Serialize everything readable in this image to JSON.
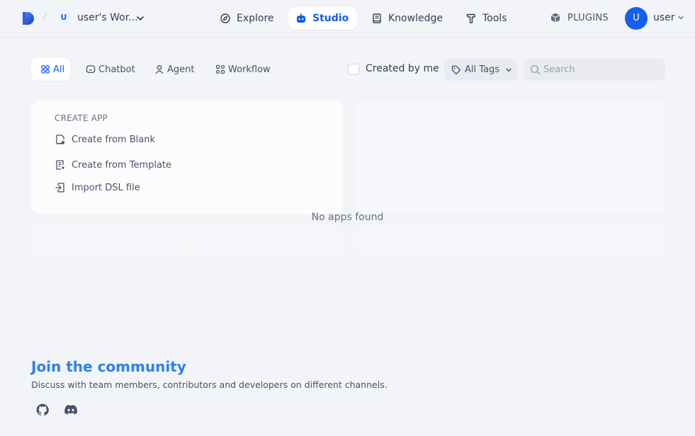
{
  "header": {
    "workspace": {
      "initial": "U",
      "name": "user's Wor..."
    },
    "nav": [
      {
        "label": "Explore",
        "icon": "compass-icon"
      },
      {
        "label": "Studio",
        "icon": "robot-icon",
        "active": true
      },
      {
        "label": "Knowledge",
        "icon": "book-icon"
      },
      {
        "label": "Tools",
        "icon": "hammer-icon"
      }
    ],
    "plugins_label": "PLUGINS",
    "user": {
      "initial": "U",
      "name": "user"
    },
    "accent_color": "#155eef"
  },
  "filters": {
    "tabs": [
      {
        "label": "All",
        "icon": "grid-icon",
        "active": true
      },
      {
        "label": "Chatbot",
        "icon": "chat-icon"
      },
      {
        "label": "Agent",
        "icon": "agent-icon"
      },
      {
        "label": "Workflow",
        "icon": "workflow-icon"
      }
    ],
    "created_by_me_label": "Created by me",
    "created_by_me_checked": false,
    "tags_label": "All Tags",
    "search_placeholder": "Search",
    "search_value": ""
  },
  "create_app": {
    "title": "CREATE APP",
    "options": [
      {
        "label": "Create from Blank",
        "icon": "file-plus-icon"
      },
      {
        "label": "Create from Template",
        "icon": "file-template-icon"
      },
      {
        "label": "Import DSL file",
        "icon": "file-import-icon"
      }
    ]
  },
  "empty_state": "No apps found",
  "community": {
    "title": "Join the community",
    "description": "Discuss with team members, contributors and developers on different channels.",
    "links": [
      {
        "icon": "github-icon"
      },
      {
        "icon": "discord-icon"
      }
    ],
    "title_color": "#2f80ed"
  }
}
